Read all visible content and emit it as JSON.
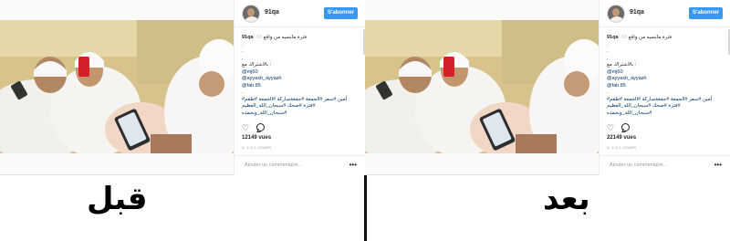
{
  "panels": [
    {
      "id": "before",
      "post": {
        "username": "91qa",
        "follow_label": "S'abonner",
        "caption_user": "91qa",
        "caption_text": "فترة مانسيه من واقع",
        "caption_time": "03",
        "dots": [
          ".",
          ".",
          "."
        ],
        "share_line": "بالاشتراك مع :",
        "mentions": [
          "@mj60",
          "@ayyash_ayyash",
          "@fah.85"
        ],
        "dot_after": ".",
        "hashtags_line1": "أمين #سعر #الجمعة #جمعةمباركة #الجمعة #طقم#",
        "hashtags_line2": "#فترة #ضحك #سبحان_الله_العظيم #سبحان_الله_وبحمده",
        "views": "12149 vues",
        "timestamp": "IL Y A 1 JOURS",
        "add_comment_placeholder": "Ajouter un commentaire...",
        "more_label": "•••"
      }
    },
    {
      "id": "after",
      "post": {
        "username": "91qa",
        "follow_label": "S'abonner",
        "caption_user": "91qa",
        "caption_text": "فترة مانسيه من واقع",
        "caption_time": "03",
        "dots": [
          ".",
          ".",
          "."
        ],
        "share_line": "بالاشتراك مع :",
        "mentions": [
          "@mj60",
          "@ayyash_ayyash",
          "@fah.85"
        ],
        "dot_after": ".",
        "hashtags_line1": "أمين #سعر #الجمعة #جمعةمباركة #الجمعة #طقم#",
        "hashtags_line2": "#فترة #ضحك #سبحان_الله_العظيم #سبحان_الله_وبحمده",
        "views": "22149 vues",
        "timestamp": "IL Y A 1 JOURS",
        "add_comment_placeholder": "Ajouter un commentaire...",
        "more_label": "•••"
      }
    }
  ],
  "labels": {
    "before": "قبل",
    "after": "بعد"
  },
  "icons": {
    "like": "heart-icon",
    "comment": "comment-icon"
  },
  "colors": {
    "follow_button": "#3897f0",
    "link": "#003569",
    "divider": "#111111"
  }
}
